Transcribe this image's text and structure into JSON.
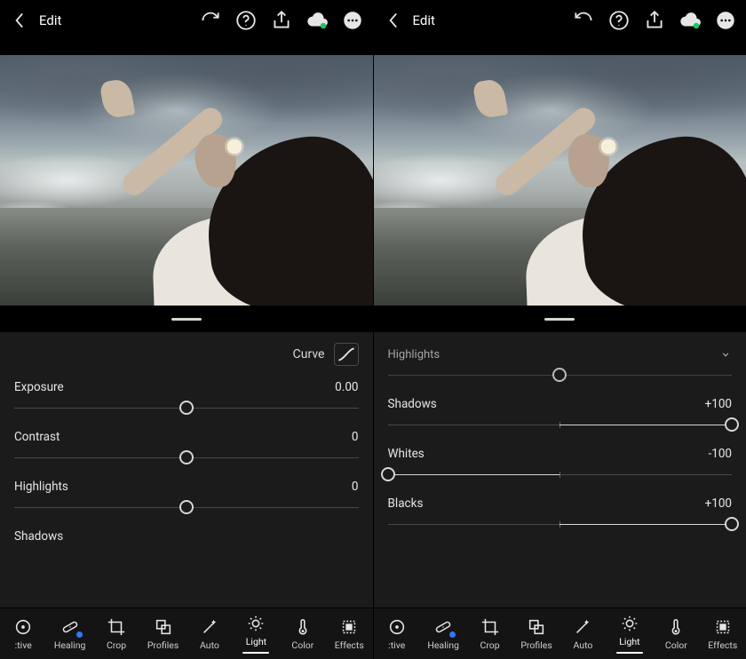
{
  "panes": [
    {
      "header": {
        "edit_label": "Edit"
      },
      "curve_label": "Curve",
      "sliders": [
        {
          "name": "Exposure",
          "value": "0.00",
          "pos": 50,
          "fill_from": 50,
          "fill_to": 50
        },
        {
          "name": "Contrast",
          "value": "0",
          "pos": 50,
          "fill_from": 50,
          "fill_to": 50
        },
        {
          "name": "Highlights",
          "value": "0",
          "pos": 50,
          "fill_from": 50,
          "fill_to": 50
        }
      ],
      "partial_next": "Shadows"
    },
    {
      "header": {
        "edit_label": "Edit"
      },
      "top_partial": "Highlights",
      "sliders": [
        {
          "name": "Shadows",
          "value": "+100",
          "pos": 100,
          "fill_from": 50,
          "fill_to": 100
        },
        {
          "name": "Whites",
          "value": "-100",
          "pos": 0,
          "fill_from": 0,
          "fill_to": 50
        },
        {
          "name": "Blacks",
          "value": "+100",
          "pos": 100,
          "fill_from": 50,
          "fill_to": 100
        }
      ]
    }
  ],
  "tool_groups": [
    [
      {
        "id": "selective",
        "label": ":tive",
        "icon": "target",
        "blue": false
      },
      {
        "id": "healing",
        "label": "Healing",
        "icon": "bandage",
        "blue": true
      },
      {
        "id": "crop",
        "label": "Crop",
        "icon": "crop",
        "blue": false
      },
      {
        "id": "profiles",
        "label": "Profiles",
        "icon": "profiles",
        "blue": false
      }
    ],
    [
      {
        "id": "auto",
        "label": "Auto",
        "icon": "wand",
        "blue": false
      },
      {
        "id": "light",
        "label": "Light",
        "icon": "light",
        "blue": false,
        "active": true
      },
      {
        "id": "color",
        "label": "Color",
        "icon": "thermo",
        "blue": false
      },
      {
        "id": "effects",
        "label": "Effects",
        "icon": "effects",
        "blue": false
      }
    ]
  ]
}
